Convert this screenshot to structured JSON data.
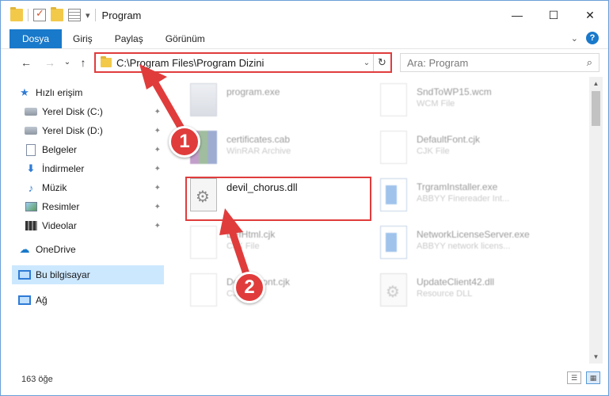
{
  "window": {
    "title": "Program",
    "minimize_glyph": "—",
    "maximize_glyph": "☐",
    "close_glyph": "✕"
  },
  "ribbon": {
    "tabs": [
      "Dosya",
      "Giriş",
      "Paylaş",
      "Görünüm"
    ],
    "help_glyph": "?",
    "collapse_glyph": "⌄"
  },
  "navigation": {
    "back_glyph": "←",
    "forward_glyph": "→",
    "recent_glyph": "⌄",
    "up_glyph": "↑"
  },
  "address": {
    "path": "C:\\Program Files\\Program Dizini",
    "dropdown_glyph": "⌄",
    "refresh_glyph": "↻"
  },
  "search": {
    "placeholder": "Ara: Program",
    "icon_glyph": "⌕"
  },
  "nav_pane": {
    "items": [
      {
        "label": "Hızlı erişim",
        "icon": "star-icon",
        "pinned": false
      },
      {
        "label": "Yerel Disk (C:)",
        "icon": "drive-icon",
        "pinned": true
      },
      {
        "label": "Yerel Disk (D:)",
        "icon": "drive-icon",
        "pinned": true
      },
      {
        "label": "Belgeler",
        "icon": "document-icon",
        "pinned": true
      },
      {
        "label": "İndirmeler",
        "icon": "download-icon",
        "pinned": true
      },
      {
        "label": "Müzik",
        "icon": "music-icon",
        "pinned": true
      },
      {
        "label": "Resimler",
        "icon": "pictures-icon",
        "pinned": true
      },
      {
        "label": "Videolar",
        "icon": "videos-icon",
        "pinned": true
      },
      {
        "label": "OneDrive",
        "icon": "cloud-icon",
        "pinned": false
      },
      {
        "label": "Bu bilgisayar",
        "icon": "computer-icon",
        "pinned": false,
        "selected": true
      },
      {
        "label": "Ağ",
        "icon": "network-icon",
        "pinned": false
      }
    ],
    "pin_glyph": "📌"
  },
  "files": [
    {
      "name": "program.exe",
      "type": "",
      "icon": "exe-icon",
      "faded": true
    },
    {
      "name": "SndToWP15.wcm",
      "type": "WCM File",
      "icon": "blank-file-icon",
      "faded": true
    },
    {
      "name": "certificates.cab",
      "type": "WinRAR Archive",
      "icon": "cab-icon",
      "faded": true
    },
    {
      "name": "DefaultFont.cjk",
      "type": "CJK File",
      "icon": "blank-file-icon",
      "faded": true
    },
    {
      "name": "devil_chorus.dll",
      "type": "",
      "icon": "dll-icon",
      "faded": false,
      "highlighted": true
    },
    {
      "name": "TrgramInstaller.exe",
      "type": "ABBYY Finereader Int...",
      "icon": "app-icon",
      "faded": true
    },
    {
      "name": "DefHtml.cjk",
      "type": "CJK File",
      "icon": "blank-file-icon",
      "faded": true
    },
    {
      "name": "NetworkLicenseServer.exe",
      "type": "ABBYY network licens...",
      "icon": "app-icon",
      "faded": true
    },
    {
      "name": "DefaultFont.cjk",
      "type": "CJK File",
      "icon": "blank-file-icon",
      "faded": true
    },
    {
      "name": "UpdateClient42.dll",
      "type": "Resource DLL",
      "icon": "dll-icon",
      "faded": true
    }
  ],
  "status": {
    "count_text": "163 öğe"
  },
  "annotations": {
    "step1": "1",
    "step2": "2",
    "accent_color": "#e03c3c"
  }
}
